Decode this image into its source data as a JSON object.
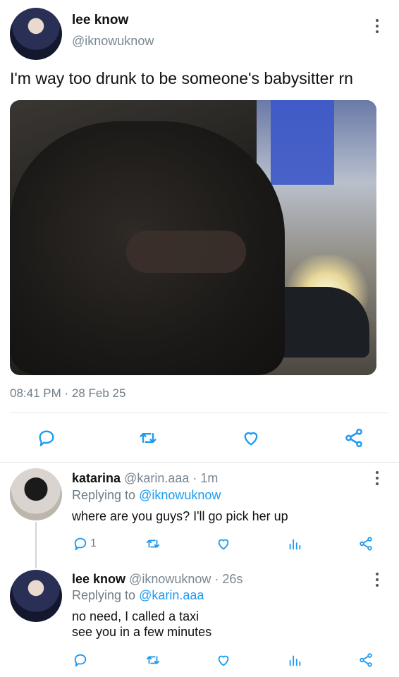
{
  "main_tweet": {
    "display_name": "lee know",
    "handle": "@iknowuknow",
    "text": "I'm way too drunk to be someone's babysitter rn",
    "timestamp": "08:41 PM · 28 Feb 25"
  },
  "reply1": {
    "display_name": "katarina",
    "handle": "@karin.aaa",
    "time": "· 1m",
    "replying_prefix": "Replying to",
    "replying_to": "@iknowuknow",
    "text": "where are you guys? I'll go pick her up",
    "reply_count": "1"
  },
  "reply2": {
    "display_name": "lee know",
    "handle": "@iknowuknow",
    "time": "· 26s",
    "replying_prefix": "Replying to",
    "replying_to": "@karin.aaa",
    "text_line1": "no need, I called a taxi",
    "text_line2": "see you in a few minutes"
  },
  "colors": {
    "accent": "#1d9bf0",
    "muted": "#6f7d87"
  },
  "icons": [
    "more-icon",
    "reply-icon",
    "retweet-icon",
    "like-icon",
    "share-icon",
    "stats-icon"
  ]
}
